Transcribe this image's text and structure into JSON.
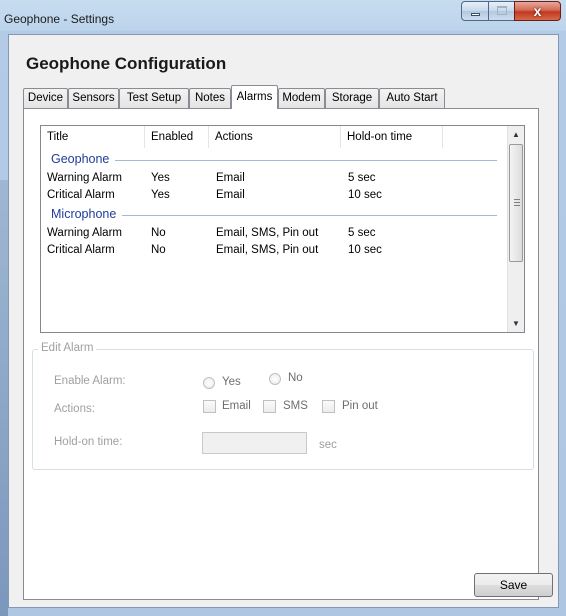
{
  "window": {
    "title": "Geophone - Settings",
    "close_glyph": "x",
    "icons": [
      "minimize-icon",
      "maximize-icon",
      "close-icon"
    ]
  },
  "heading": "Geophone Configuration",
  "tabs": [
    {
      "label": "Device",
      "active": false
    },
    {
      "label": "Sensors",
      "active": false
    },
    {
      "label": "Test Setup",
      "active": false
    },
    {
      "label": "Notes",
      "active": false
    },
    {
      "label": "Alarms",
      "active": true
    },
    {
      "label": "Modem",
      "active": false
    },
    {
      "label": "Storage",
      "active": false
    },
    {
      "label": "Auto Start",
      "active": false
    }
  ],
  "alarm_list": {
    "columns": [
      "Title",
      "Enabled",
      "Actions",
      "Hold-on time"
    ],
    "groups": [
      {
        "name": "Geophone",
        "rows": [
          {
            "title": "Warning Alarm",
            "enabled": "Yes",
            "actions": "Email",
            "hold": "5 sec"
          },
          {
            "title": "Critical Alarm",
            "enabled": "Yes",
            "actions": "Email",
            "hold": "10 sec"
          }
        ]
      },
      {
        "name": "Microphone",
        "rows": [
          {
            "title": "Warning Alarm",
            "enabled": "No",
            "actions": "Email, SMS, Pin out",
            "hold": "5 sec"
          },
          {
            "title": "Critical Alarm",
            "enabled": "No",
            "actions": "Email, SMS, Pin out",
            "hold": "10 sec"
          }
        ]
      }
    ],
    "scroll_up_glyph": "▲",
    "scroll_down_glyph": "▼"
  },
  "edit_alarm": {
    "legend": "Edit Alarm",
    "enable_label": "Enable Alarm:",
    "yes_label": "Yes",
    "no_label": "No",
    "actions_label": "Actions:",
    "email_label": "Email",
    "sms_label": "SMS",
    "pinout_label": "Pin out",
    "holdon_label": "Hold-on time:",
    "holdon_value": "",
    "unit_label": "sec"
  },
  "save_label": "Save",
  "colors": {
    "group_header": "#1f3d9c",
    "disabled_text": "#a0a0a0",
    "close_button": "#c0381f"
  }
}
